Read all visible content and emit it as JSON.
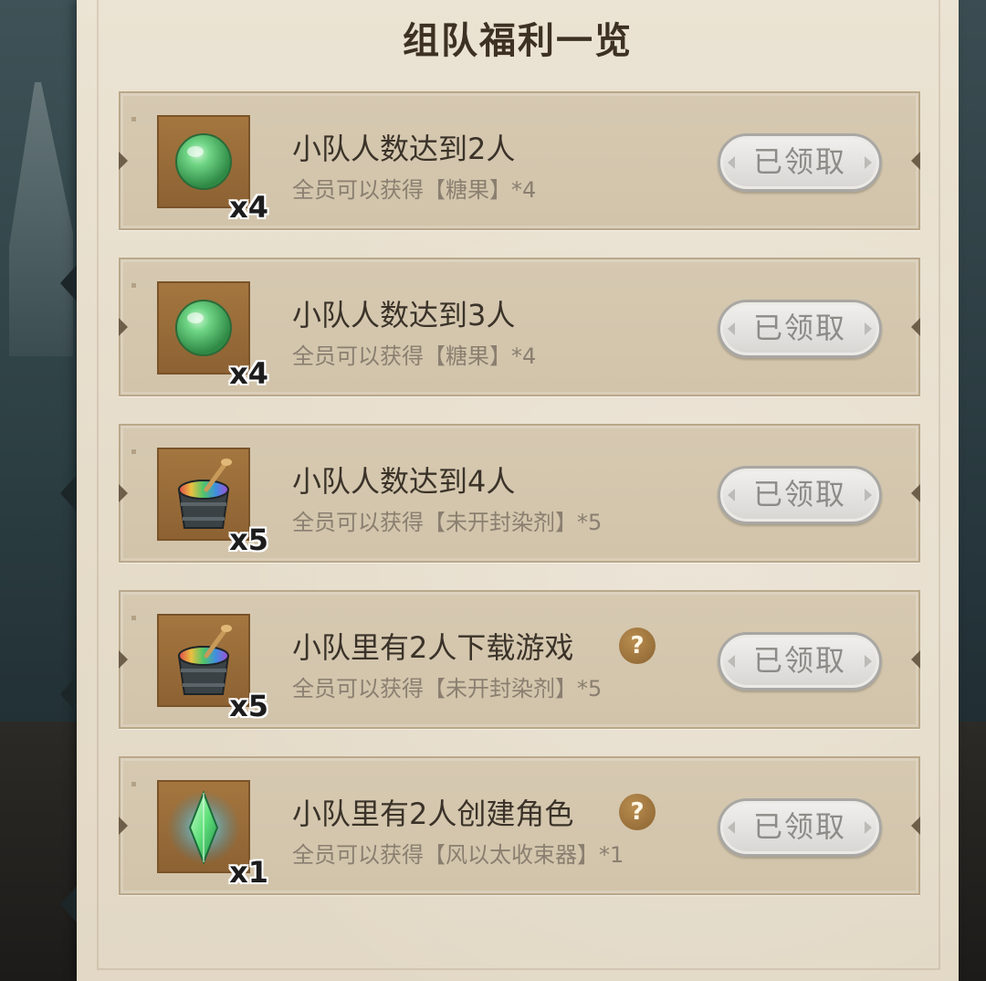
{
  "title": "组队福利一览",
  "items": [
    {
      "icon": "candy-icon",
      "qty": "x4",
      "title": "小队人数达到2人",
      "desc": "全员可以获得【糖果】*4",
      "help": false,
      "claim_label": "已领取"
    },
    {
      "icon": "candy-icon",
      "qty": "x4",
      "title": "小队人数达到3人",
      "desc": "全员可以获得【糖果】*4",
      "help": false,
      "claim_label": "已领取"
    },
    {
      "icon": "dye-bucket-icon",
      "qty": "x5",
      "title": "小队人数达到4人",
      "desc": "全员可以获得【未开封染剂】*5",
      "help": false,
      "claim_label": "已领取"
    },
    {
      "icon": "dye-bucket-icon",
      "qty": "x5",
      "title": "小队里有2人下载游戏",
      "desc": "全员可以获得【未开封染剂】*5",
      "help": true,
      "help_label": "?",
      "claim_label": "已领取"
    },
    {
      "icon": "wind-crystal-icon",
      "qty": "x1",
      "title": "小队里有2人创建角色",
      "desc": "全员可以获得【风以太收束器】*1",
      "help": true,
      "help_label": "?",
      "claim_label": "已领取"
    }
  ]
}
